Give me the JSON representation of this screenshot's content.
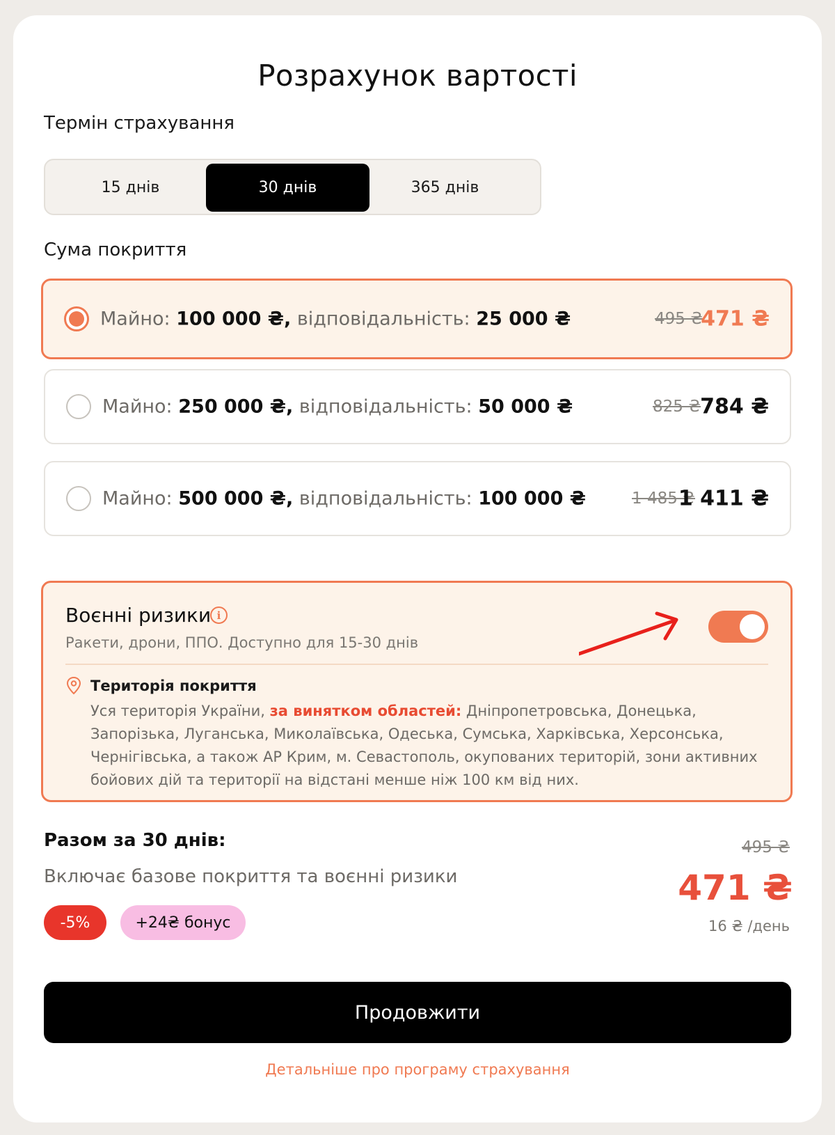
{
  "title": "Розрахунок вартості",
  "term": {
    "label": "Термін страхування",
    "options": [
      "15 днів",
      "30 днів",
      "365 днів"
    ],
    "selected": "30 днів"
  },
  "coverage": {
    "label": "Сума покриття",
    "property_label": "Майно:",
    "liability_label": "відповідальність:",
    "options": [
      {
        "property": "100 000 ₴,",
        "liability": "25 000 ₴",
        "old_price": "495 ₴",
        "price": "471 ₴",
        "selected": true
      },
      {
        "property": "250 000 ₴,",
        "liability": "50 000 ₴",
        "old_price": "825 ₴",
        "price": "784 ₴",
        "selected": false
      },
      {
        "property": "500 000 ₴,",
        "liability": "100 000 ₴",
        "old_price": "1 485 ₴",
        "price": "1 411 ₴",
        "selected": false
      }
    ]
  },
  "war_risks": {
    "title": "Воєнні ризики",
    "subtitle": "Ракети, дрони, ППО. Доступно для 15-30 днів",
    "enabled": true,
    "territory_title": "Територія покриття",
    "territory_text_a": "Уся територія України,",
    "territory_text_red": "за винятком областей:",
    "territory_text_b": "Дніпропетровська, Донецька, Запорізька, Луганська, Миколаївська, Одеська, Сумська, Харківська, Херсонська, Чернігівська, а також АР Крим, м. Севастополь, окупованих територій, зони активних бойових дій та території на відстані менше ніж 100 км від них."
  },
  "total": {
    "label": "Разом за 30 днів:",
    "subtitle": "Включає базове покриття та воєнні ризики",
    "discount_badge": "-5%",
    "bonus_badge": "+24₴ бонус",
    "old_price": "495 ₴",
    "price": "471 ₴",
    "per_day": "16 ₴ /день"
  },
  "continue_label": "Продовжити",
  "details_link": "Детальніше про програму страхування",
  "colors": {
    "accent": "#f07a52",
    "discount": "#e8352b",
    "bonus": "#f8bde3",
    "total_price": "#e8503b",
    "background": "#efece8"
  }
}
